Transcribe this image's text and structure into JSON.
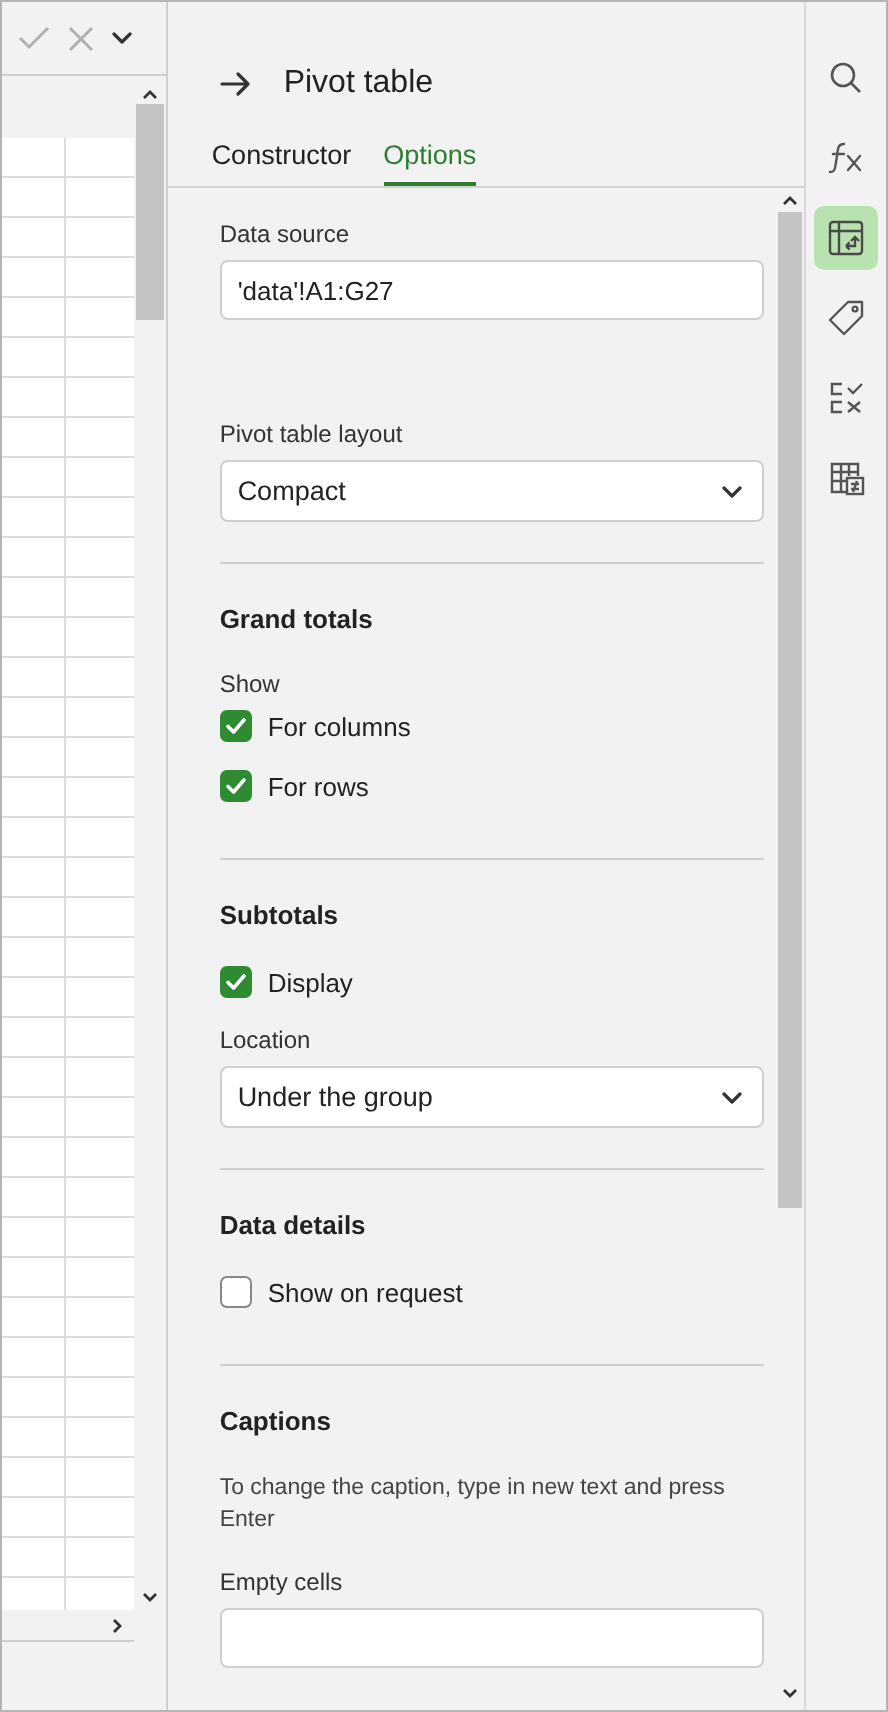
{
  "panel": {
    "title": "Pivot table",
    "tabs": [
      {
        "label": "Constructor",
        "selected": false
      },
      {
        "label": "Options",
        "selected": true
      }
    ],
    "sections": [
      {
        "items": [
          {
            "kind": "label",
            "text": "Data source"
          },
          {
            "kind": "input",
            "value": "'data'!A1:G27"
          },
          {
            "kind": "spacer"
          },
          {
            "kind": "label",
            "text": "Pivot table layout"
          },
          {
            "kind": "select",
            "value": "Compact"
          }
        ]
      },
      {
        "heading": "Grand totals",
        "items": [
          {
            "kind": "label",
            "text": "Show"
          },
          {
            "kind": "checkbox",
            "text": "For columns",
            "checked": true
          },
          {
            "kind": "checkbox",
            "text": "For rows",
            "checked": true
          }
        ]
      },
      {
        "heading": "Subtotals",
        "items": [
          {
            "kind": "checkbox",
            "text": "Display",
            "checked": true
          },
          {
            "kind": "label",
            "text": "Location"
          },
          {
            "kind": "select",
            "value": "Under the group"
          }
        ]
      },
      {
        "heading": "Data details",
        "items": [
          {
            "kind": "checkbox",
            "text": "Show on request",
            "checked": false
          }
        ]
      },
      {
        "heading": "Captions",
        "items": [
          {
            "kind": "note",
            "text": "To change the caption, type in new text and press Enter"
          },
          {
            "kind": "label",
            "text": "Empty cells"
          },
          {
            "kind": "input",
            "value": ""
          }
        ]
      }
    ]
  },
  "toolbar": [
    {
      "kind": "search",
      "selected": false
    },
    {
      "kind": "function",
      "selected": false
    },
    {
      "kind": "pivot",
      "selected": true
    },
    {
      "kind": "tag",
      "selected": false
    },
    {
      "kind": "checklist",
      "selected": false
    },
    {
      "kind": "table",
      "selected": false
    }
  ]
}
